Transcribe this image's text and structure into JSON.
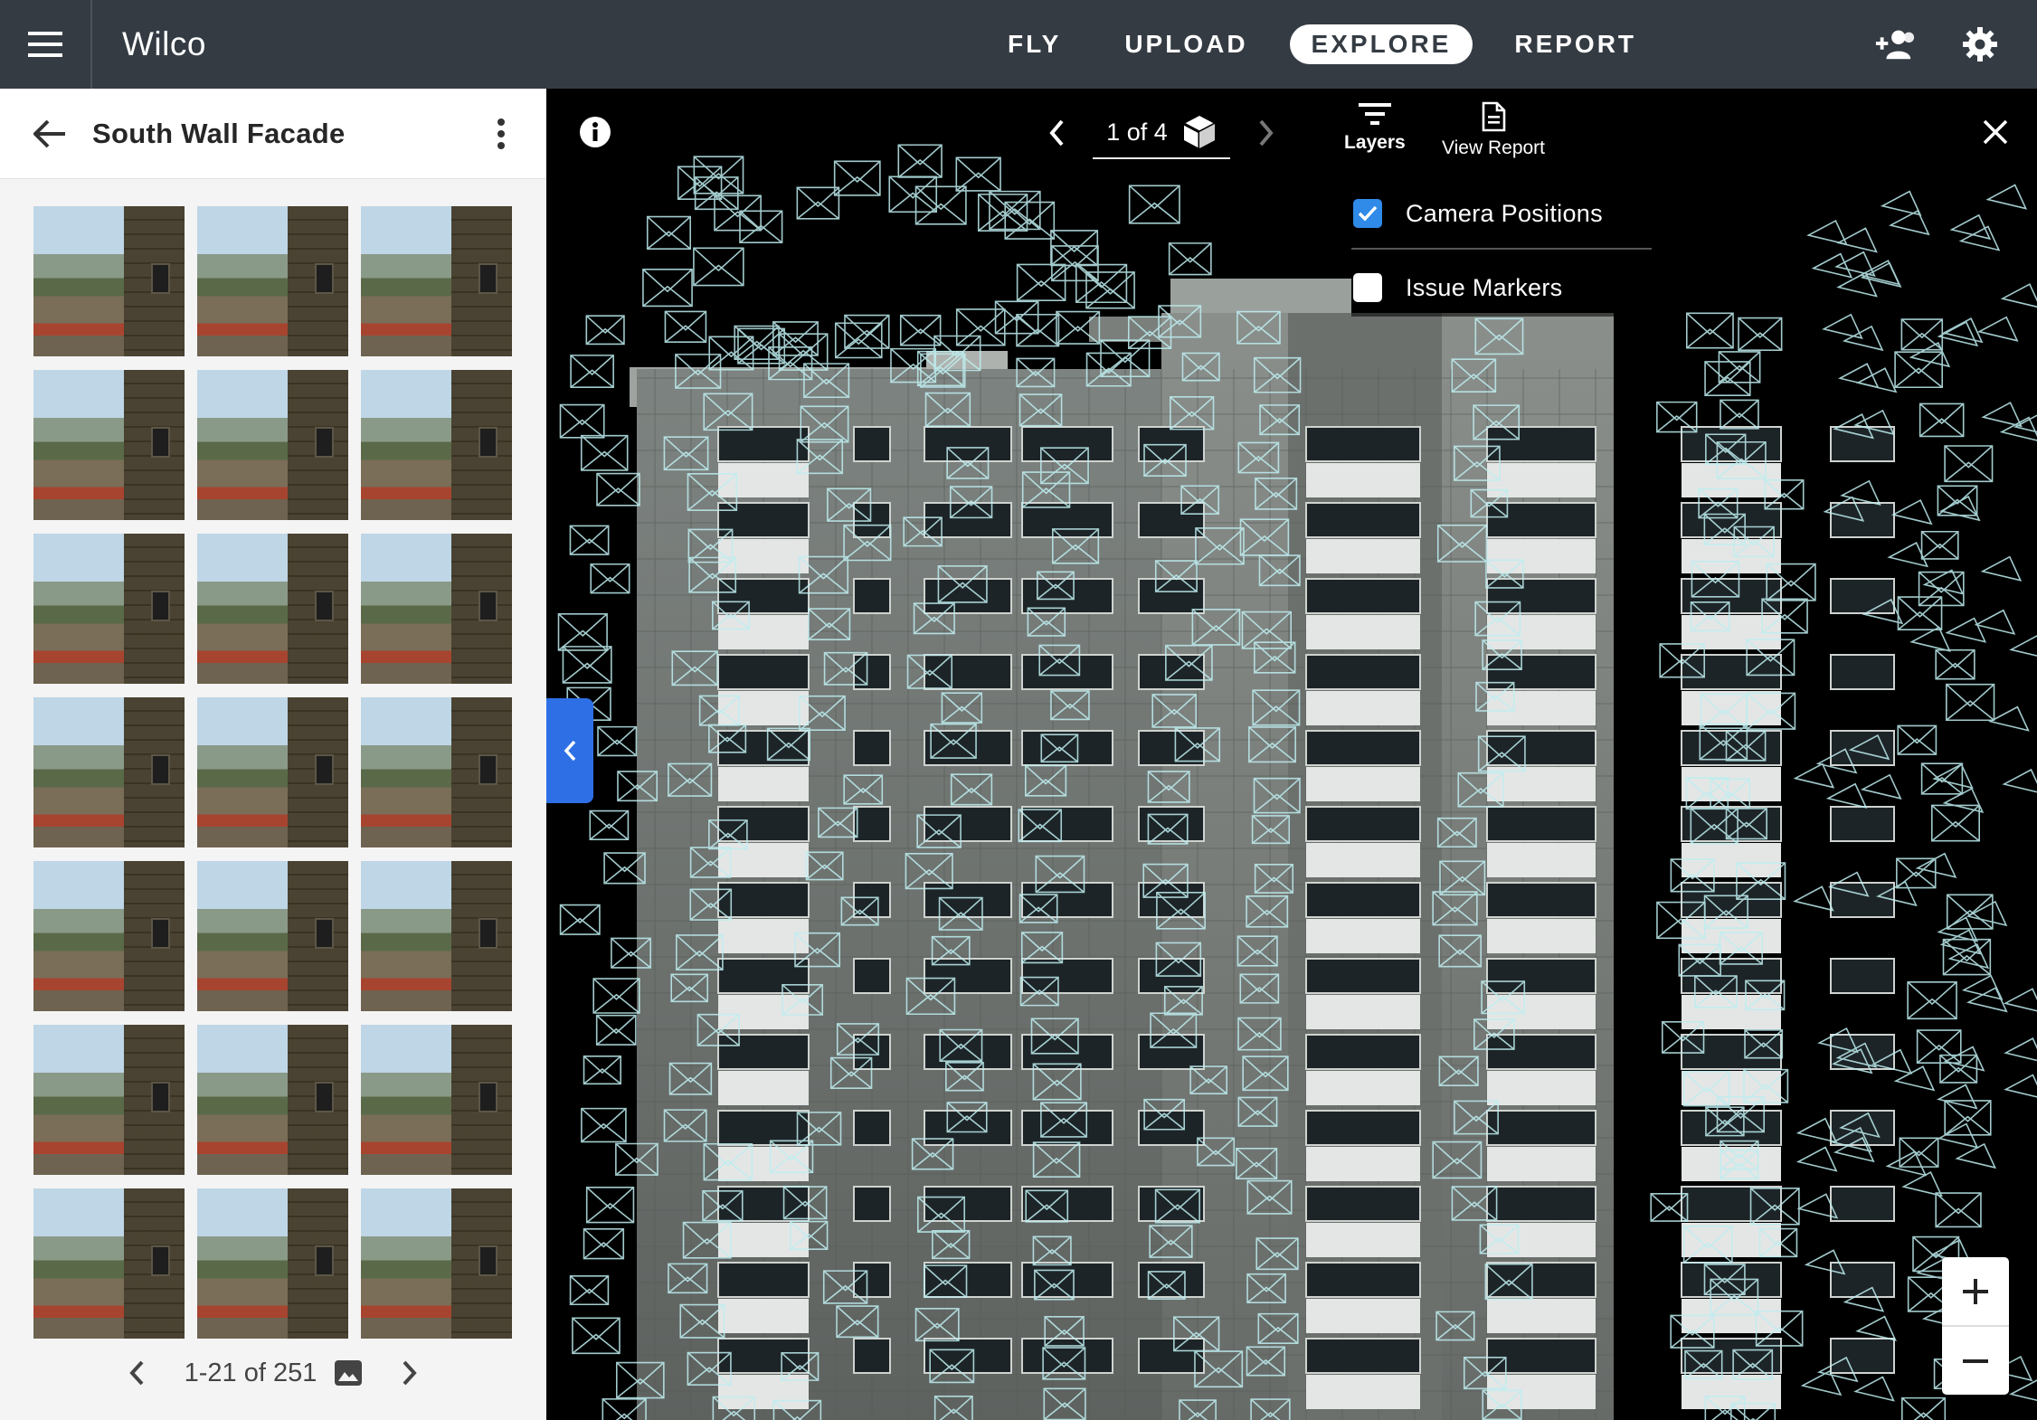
{
  "app": {
    "title": "Wilco"
  },
  "nav": {
    "items": [
      "FLY",
      "UPLOAD",
      "EXPLORE",
      "REPORT"
    ],
    "active": "EXPLORE"
  },
  "header_icons": [
    "add-user-icon",
    "settings-icon"
  ],
  "sidebar": {
    "title": "South Wall Facade",
    "thumbnails_visible": 21,
    "pager": {
      "range_text": "1-21 of 251"
    }
  },
  "viewer": {
    "pagination": {
      "text": "1 of 4"
    },
    "tools": {
      "layers_label": "Layers",
      "view_report_label": "View Report"
    },
    "layers": [
      {
        "label": "Camera Positions",
        "checked": true
      },
      {
        "label": "Issue Markers",
        "checked": false
      }
    ],
    "zoom": {
      "in": "+",
      "out": "−"
    }
  },
  "colors": {
    "appbar": "#343b43",
    "accent": "#2f6fe6",
    "checkbox": "#2f8ae8"
  }
}
